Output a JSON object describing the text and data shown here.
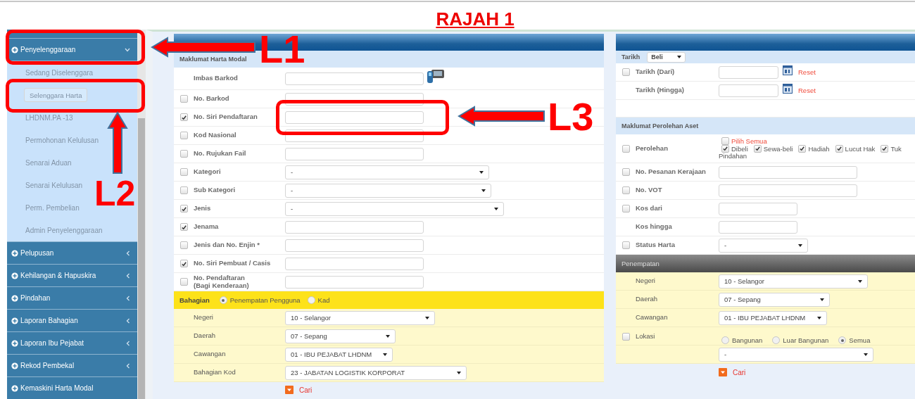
{
  "title": "RAJAH 1",
  "annotations": [
    {
      "label": "L1"
    },
    {
      "label": "L2"
    },
    {
      "label": "L3"
    }
  ],
  "sidebar": {
    "items": [
      {
        "label": "Penyelenggaraan",
        "expanded": true,
        "children": [
          {
            "label": "Sedang Diselenggara",
            "selected": false
          },
          {
            "label": "Selenggara Harta",
            "selected": true
          },
          {
            "label": "LHDNM.PA -13",
            "selected": false
          },
          {
            "label": "Permohonan Kelulusan",
            "selected": false
          },
          {
            "label": "Senarai Aduan",
            "selected": false
          },
          {
            "label": "Senarai Kelulusan",
            "selected": false
          },
          {
            "label": "Perm. Pembelian",
            "selected": false
          },
          {
            "label": "Admin Penyelenggaraan",
            "selected": false
          }
        ]
      },
      {
        "label": "Pelupusan",
        "expanded": false
      },
      {
        "label": "Kehilangan & Hapuskira",
        "expanded": false
      },
      {
        "label": "Pindahan",
        "expanded": false
      },
      {
        "label": "Laporan Bahagian",
        "expanded": false
      },
      {
        "label": "Laporan Ibu Pejabat",
        "expanded": false
      },
      {
        "label": "Rekod Pembekal",
        "expanded": false
      },
      {
        "label": "Kemaskini Harta Modal"
      }
    ]
  },
  "asset_form": {
    "title": "Maklumat Harta Modal",
    "rows": [
      {
        "kind": "scan",
        "label": "Imbas Barkod"
      },
      {
        "kind": "text",
        "label": "No. Barkod",
        "checked": false
      },
      {
        "kind": "text",
        "label": "No. Siri Pendaftaran",
        "checked": true
      },
      {
        "kind": "text",
        "label": "Kod Nasional",
        "checked": false
      },
      {
        "kind": "text",
        "label": "No. Rujukan Fail",
        "checked": false
      },
      {
        "kind": "select",
        "label": "Kategori",
        "checked": false,
        "value": "-"
      },
      {
        "kind": "select",
        "label": "Sub Kategori",
        "checked": false,
        "value": "-"
      },
      {
        "kind": "select",
        "label": "Jenis",
        "checked": true,
        "value": "-"
      },
      {
        "kind": "text",
        "label": "Jenama",
        "checked": true
      },
      {
        "kind": "text",
        "label": "Jenis dan No. Enjin *",
        "checked": false
      },
      {
        "kind": "text",
        "label": "No. Siri Pembuat / Casis",
        "checked": true
      },
      {
        "kind": "text",
        "label": "No. Pendaftaran\n(Bagi Kenderaan)",
        "checked": false
      }
    ]
  },
  "bahagian": {
    "title": "Bahagian",
    "options": [
      {
        "label": "Penempatan Pengguna",
        "selected": true
      },
      {
        "label": "Kad",
        "selected": false
      }
    ],
    "rows": [
      {
        "label": "Negeri",
        "value": "10 - Selangor"
      },
      {
        "label": "Daerah",
        "value": "07 - Sepang"
      },
      {
        "label": "Cawangan",
        "value": "01 - IBU PEJABAT LHDNM"
      },
      {
        "label": "Bahagian Kod",
        "value": "23 - JABATAN LOGISTIK KORPORAT"
      }
    ],
    "search_button": "Cari"
  },
  "filter_panel": {
    "date_type": {
      "label": "Tarikh",
      "value": "Beli"
    },
    "date_rows": [
      {
        "label": "Tarikh (Dari)",
        "checked": false,
        "reset": "Reset"
      },
      {
        "label": "Tarikh (Hingga)",
        "reset": "Reset"
      }
    ],
    "acquisition": {
      "title": "Maklumat Perolehan Aset",
      "perolehan": {
        "label": "Perolehan",
        "checked": false,
        "select_all": {
          "label": "Pilih Semua",
          "checked": false
        },
        "options": [
          {
            "label": "Dibeli",
            "checked": true
          },
          {
            "label": "Sewa-beli",
            "checked": true
          },
          {
            "label": "Hadiah",
            "checked": true
          },
          {
            "label": "Lucut Hak",
            "checked": true
          },
          {
            "label": "Tuk",
            "checked": true
          }
        ],
        "overflow_text": "Pindahan"
      },
      "rows": [
        {
          "kind": "text",
          "label": "No. Pesanan Kerajaan",
          "checked": false
        },
        {
          "kind": "text",
          "label": "No. VOT",
          "checked": false
        },
        {
          "kind": "short",
          "label": "Kos dari",
          "checked": false
        },
        {
          "kind": "short",
          "label": "Kos hingga"
        },
        {
          "kind": "select",
          "label": "Status Harta",
          "checked": false,
          "value": "-"
        }
      ]
    },
    "placement": {
      "title": "Penempatan",
      "rows": [
        {
          "label": "Negeri",
          "value": "10 - Selangor"
        },
        {
          "label": "Daerah",
          "value": "07 - Sepang"
        },
        {
          "label": "Cawangan",
          "value": "01 - IBU PEJABAT LHDNM"
        }
      ],
      "location": {
        "label": "Lokasi",
        "checked": false,
        "options": [
          {
            "label": "Bangunan",
            "selected": false
          },
          {
            "label": "Luar Bangunan",
            "selected": false
          },
          {
            "label": "Semua",
            "selected": true
          }
        ],
        "value": "-"
      }
    },
    "search_button": "Cari"
  }
}
